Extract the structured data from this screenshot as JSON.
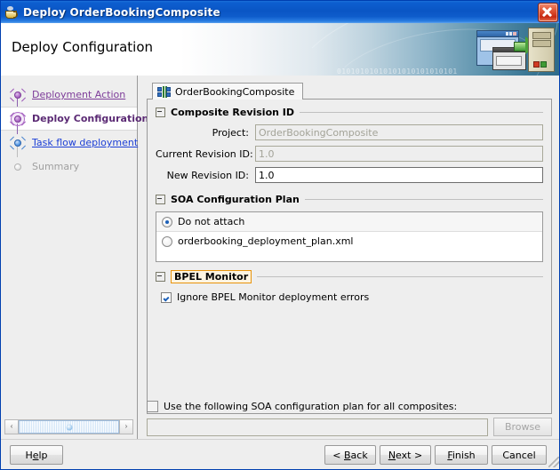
{
  "window": {
    "title": "Deploy OrderBookingComposite",
    "app_icon": "coffee-cup-icon",
    "close_label": "✕"
  },
  "banner": {
    "heading": "Deploy Configuration",
    "watermark_line1": "01010101010101010101010101",
    "watermark_line2": "0101010101010",
    "graphic": "deploy-to-server-graphic"
  },
  "sidebar": {
    "steps": [
      {
        "label": "Deployment Action",
        "state": "completed"
      },
      {
        "label": "Deploy Configuration",
        "state": "current"
      },
      {
        "label": "Task flow deployment",
        "state": "pending"
      },
      {
        "label": "Summary",
        "state": "disabled"
      }
    ],
    "scrollbar": {
      "left_arrow": "‹",
      "right_arrow": "›"
    }
  },
  "main": {
    "tab": {
      "label": "OrderBookingComposite",
      "icon": "composite-icon"
    },
    "revision_section": {
      "title": "Composite Revision ID",
      "collapsed": false,
      "fields": [
        {
          "label": "Project:",
          "value": "OrderBookingComposite",
          "enabled": false
        },
        {
          "label": "Current Revision ID:",
          "value": "1.0",
          "enabled": false
        },
        {
          "label": "New Revision ID:",
          "value": "1.0",
          "enabled": true
        }
      ]
    },
    "config_plan_section": {
      "title": "SOA Configuration Plan",
      "options": [
        {
          "label": "Do not attach",
          "selected": true
        },
        {
          "label": "orderbooking_deployment_plan.xml",
          "selected": false
        }
      ]
    },
    "bpel_monitor_section": {
      "title": "BPEL Monitor",
      "focused": true,
      "checkbox": {
        "label": "Ignore BPEL Monitor deployment errors",
        "checked": true
      }
    }
  },
  "global_plan": {
    "checkbox": {
      "label": "Use the following SOA configuration plan for all composites:",
      "checked": false
    },
    "path_value": "",
    "browse_label": "Browse"
  },
  "footer": {
    "buttons": [
      {
        "name": "help",
        "prefix": "H",
        "mnemonic": "e",
        "suffix": "lp"
      },
      {
        "name": "back",
        "prefix": "< ",
        "mnemonic": "B",
        "suffix": "ack"
      },
      {
        "name": "next",
        "prefix": "",
        "mnemonic": "N",
        "suffix": "ext >"
      },
      {
        "name": "finish",
        "prefix": "",
        "mnemonic": "F",
        "suffix": "inish"
      },
      {
        "name": "cancel",
        "prefix": "",
        "mnemonic": "",
        "suffix": "Cancel"
      }
    ]
  },
  "colors": {
    "titlebar_blue": "#0a55c4",
    "close_red": "#c62a13",
    "link_purple": "#7d3c99",
    "link_blue": "#1c3fd6",
    "focus_orange": "#e8940c",
    "panel_gray": "#eeeeee"
  }
}
